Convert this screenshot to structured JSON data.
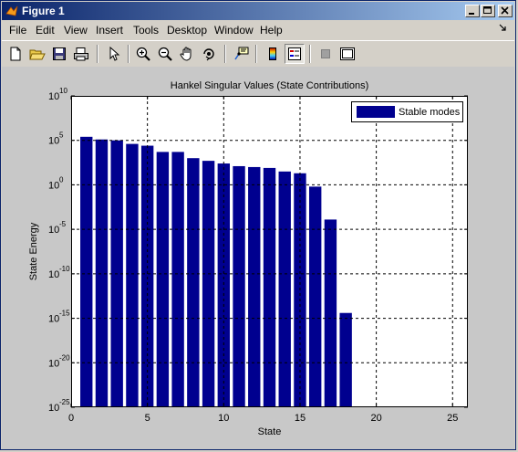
{
  "window": {
    "title": "Figure 1"
  },
  "menu": [
    "File",
    "Edit",
    "View",
    "Insert",
    "Tools",
    "Desktop",
    "Window",
    "Help"
  ],
  "toolbar": {
    "buttons": [
      "new-figure-icon",
      "open-file-icon",
      "save-icon",
      "print-icon",
      "select-arrow-icon",
      "zoom-in-icon",
      "zoom-out-icon",
      "pan-hand-icon",
      "rotate-3d-icon",
      "data-cursor-icon",
      "insert-colorbar-icon",
      "insert-legend-icon",
      "hide-plot-tools-icon",
      "show-plot-tools-icon"
    ]
  },
  "chart_data": {
    "type": "bar",
    "title": "Hankel Singular Values (State Contributions)",
    "xlabel": "State",
    "ylabel": "State Energy",
    "y_scale": "log",
    "xlim": [
      0,
      26
    ],
    "ylim_exponents": [
      -25,
      10
    ],
    "xticks": [
      "0",
      "5",
      "10",
      "15",
      "20",
      "25"
    ],
    "yticks": [
      {
        "base": "10",
        "exp": "10"
      },
      {
        "base": "10",
        "exp": "5"
      },
      {
        "base": "10",
        "exp": "0"
      },
      {
        "base": "10",
        "exp": "-5"
      },
      {
        "base": "10",
        "exp": "-10"
      },
      {
        "base": "10",
        "exp": "-15"
      },
      {
        "base": "10",
        "exp": "-20"
      },
      {
        "base": "10",
        "exp": "-25"
      }
    ],
    "grid": true,
    "legend": {
      "label": "Stable modes",
      "placement": "top-right"
    },
    "bar_color": "#00008f",
    "x": [
      1,
      2,
      3,
      4,
      5,
      6,
      7,
      8,
      9,
      10,
      11,
      12,
      13,
      14,
      15,
      16,
      17,
      18
    ],
    "log10_values": [
      5.4,
      5.1,
      5.0,
      4.6,
      4.4,
      3.7,
      3.7,
      3.0,
      2.7,
      2.4,
      2.1,
      2.0,
      1.9,
      1.5,
      1.3,
      -0.2,
      -3.9,
      -14.4
    ]
  }
}
